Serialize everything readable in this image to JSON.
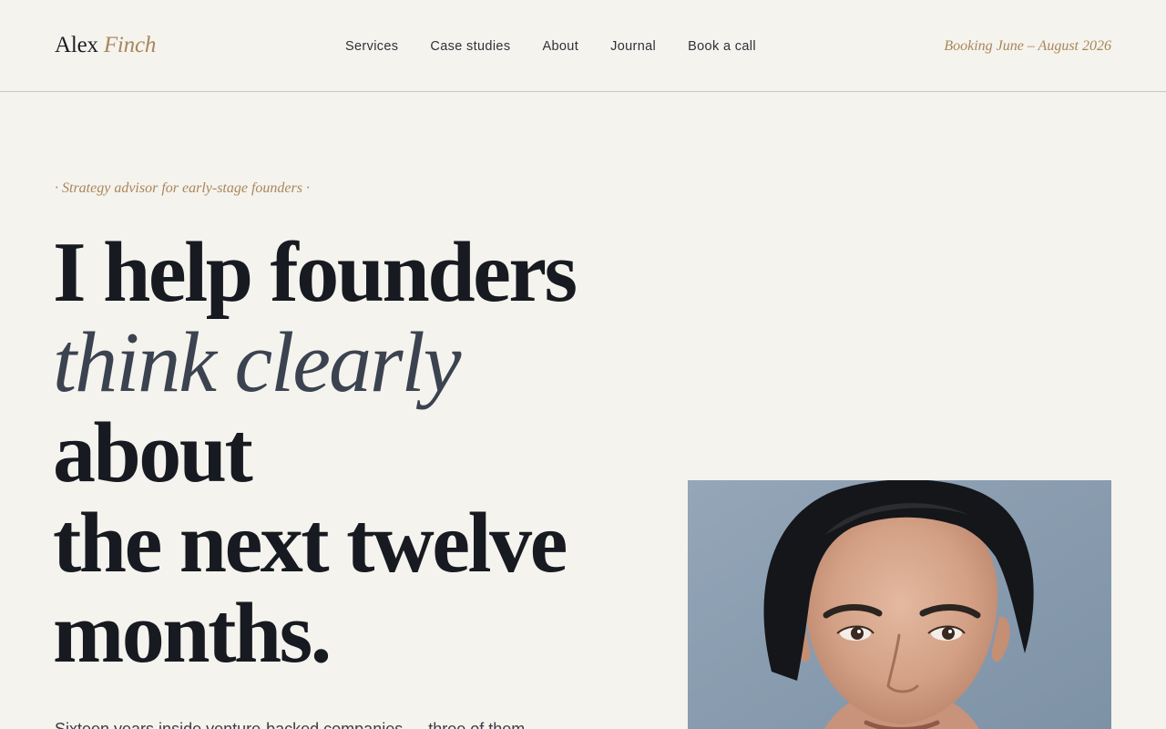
{
  "header": {
    "brand_first": "Alex",
    "brand_last": "Finch",
    "nav": [
      {
        "label": "Services"
      },
      {
        "label": "Case studies"
      },
      {
        "label": "About"
      },
      {
        "label": "Journal"
      },
      {
        "label": "Book a call"
      }
    ],
    "booking": "Booking June – August 2026"
  },
  "hero": {
    "eyebrow": "· Strategy advisor for early-stage founders ·",
    "headline": {
      "line1": "I help founders",
      "line2": "think clearly",
      "line3": "about",
      "line4": "the next twelve",
      "line5": "months."
    },
    "lede": "Sixteen years inside venture-backed companies — three of them"
  },
  "colors": {
    "background": "#f5f3ee",
    "accent": "#a8875a",
    "ink": "#171a20",
    "italic_ink": "#3b4350"
  },
  "portrait": {
    "icon": "founder-portrait-photo"
  }
}
